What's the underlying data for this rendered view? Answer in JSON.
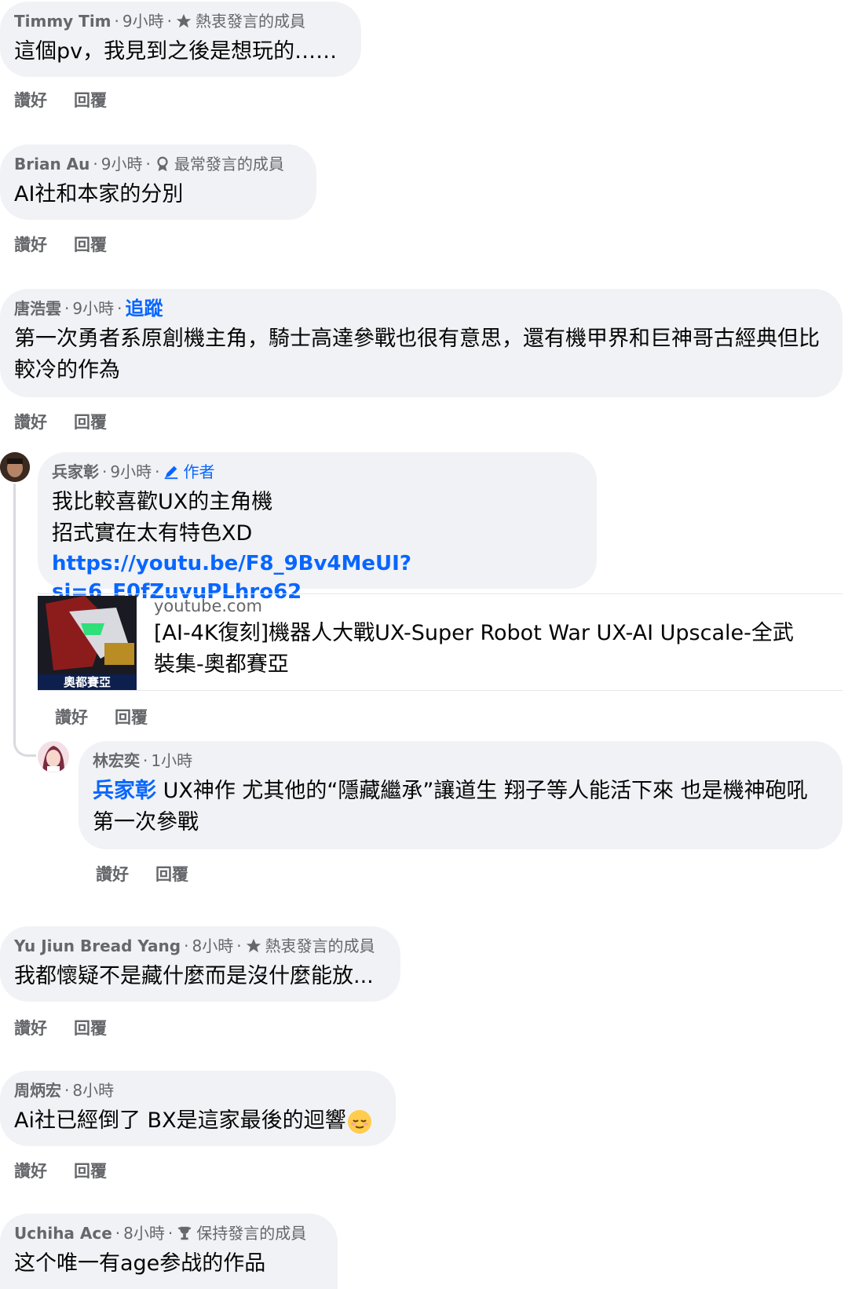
{
  "comments": [
    {
      "author": "Timmy Tim",
      "time": "9小時",
      "badge": "熱衷發言的成員",
      "badge_icon": "star-icon",
      "text": "這個pv，我見到之後是想玩的……",
      "like": "讚好",
      "reply": "回覆"
    },
    {
      "author": "Brian Au",
      "time": "9小時",
      "badge": "最常發言的成員",
      "badge_icon": "ribbon-icon",
      "text": "AI社和本家的分別",
      "like": "讚好",
      "reply": "回覆"
    },
    {
      "author": "唐浩雲",
      "time": "9小時",
      "follow": "追蹤",
      "text": "第一次勇者系原創機主角，騎士高達參戰也很有意思，還有機甲界和巨神哥古經典但比較冷的作為",
      "like": "讚好",
      "reply": "回覆"
    },
    {
      "author": "兵家彰",
      "time": "9小時",
      "badge": "作者",
      "badge_icon": "pencil-icon",
      "text_line1": "我比較喜歡UX的主角機",
      "text_line2": "招式實在太有特色XD",
      "link": "https://youtu.be/F8_9Bv4MeUI?si=6_E0fZuvuPLhro62",
      "preview": {
        "domain": "youtube.com",
        "title": "[AI-4K復刻]機器人大戰UX-Super Robot War UX-AI Upscale-全武裝集-奧都賽亞",
        "thumb_caption": "奧都賽亞"
      },
      "like": "讚好",
      "reply": "回覆"
    },
    {
      "author": "林宏奕",
      "time": "1小時",
      "mention": "兵家彰",
      "text": " UX神作 尤其他的“隱藏繼承”讓道生 翔子等人能活下來 也是機神砲吼第一次參戰",
      "like": "讚好",
      "reply": "回覆"
    },
    {
      "author": "Yu Jiun Bread Yang",
      "time": "8小時",
      "badge": "熱衷發言的成員",
      "badge_icon": "star-icon",
      "text": "我都懷疑不是藏什麼而是沒什麼能放...",
      "like": "讚好",
      "reply": "回覆"
    },
    {
      "author": "周炳宏",
      "time": "8小時",
      "text": "Ai社已經倒了 BX是這家最後的迴響",
      "emoji": "relieved-face-emoji",
      "like": "讚好",
      "reply": "回覆"
    },
    {
      "author": "Uchiha Ace",
      "time": "8小時",
      "badge": "保持發言的成員",
      "badge_icon": "trophy-icon",
      "text": "这个唯一有age参战的作品"
    }
  ],
  "colors": {
    "bubble": "#f0f2f5",
    "meta": "#65676b",
    "link": "#0866ff"
  }
}
